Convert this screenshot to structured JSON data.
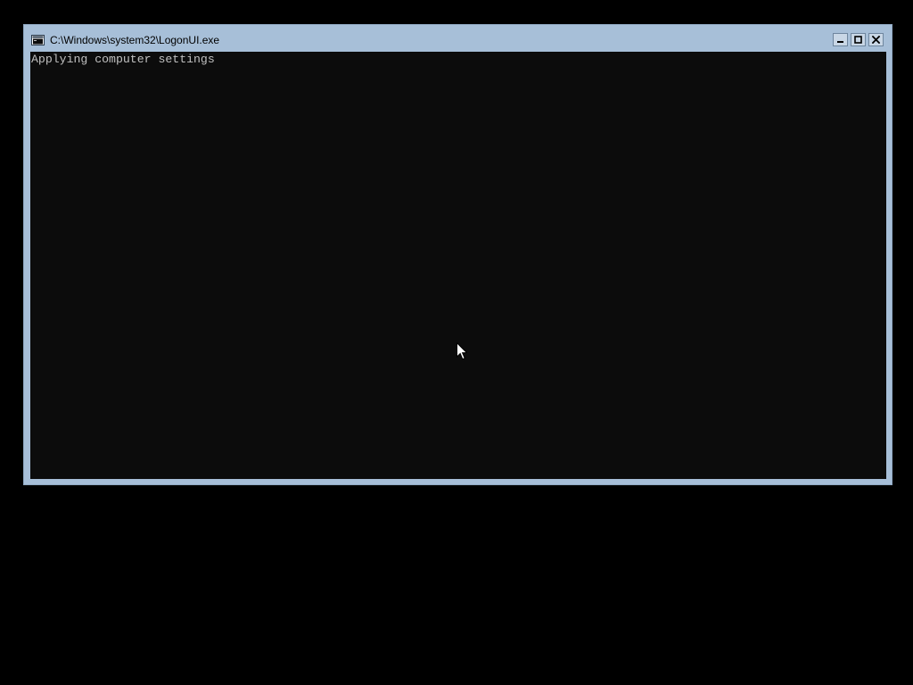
{
  "window": {
    "title": "C:\\Windows\\system32\\LogonUI.exe",
    "icon": "console-app-icon",
    "controls": {
      "minimize_icon": "minimize-icon",
      "maximize_icon": "maximize-icon",
      "close_icon": "close-icon"
    }
  },
  "console": {
    "lines": [
      "Applying computer settings"
    ]
  },
  "cursor": {
    "icon": "mouse-pointer-icon"
  },
  "colors": {
    "desktop_background": "#000000",
    "window_frame": "#a7bfd8",
    "console_background": "#0c0c0c",
    "console_text": "#c0c0c0"
  }
}
